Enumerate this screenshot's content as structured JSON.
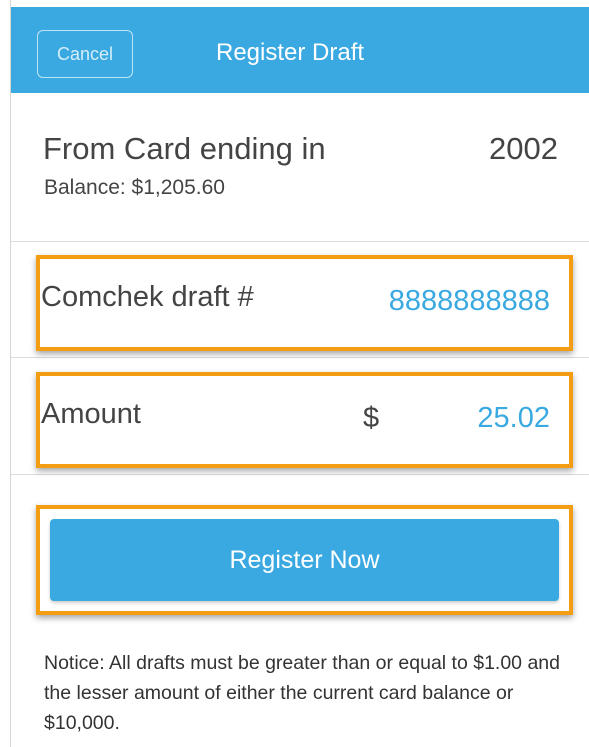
{
  "header": {
    "cancel_label": "Cancel",
    "title": "Register Draft"
  },
  "card": {
    "label": "From Card ending in",
    "number": "2002",
    "balance": "Balance: $1,205.60"
  },
  "draft": {
    "label": "Comchek draft #",
    "value": "8888888888"
  },
  "amount": {
    "label": "Amount",
    "currency": "$",
    "value": "25.02"
  },
  "register_button_label": "Register Now",
  "notice": "Notice: All drafts must be greater than or equal to $1.00 and the lesser amount of either the current card balance or $10,000.",
  "colors": {
    "accent": "#3aa9e1",
    "highlight": "#f59d12",
    "text": "#444444"
  }
}
